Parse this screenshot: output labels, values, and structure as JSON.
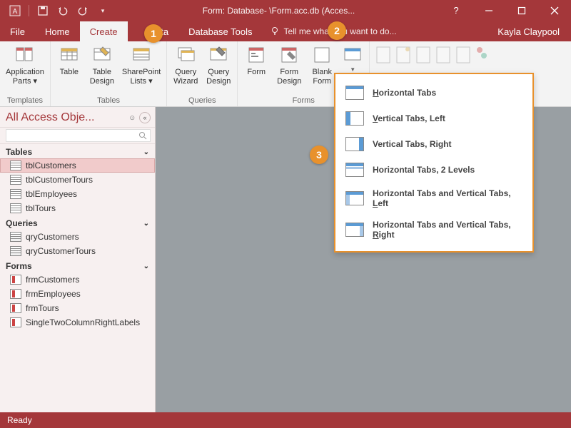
{
  "titlebar": {
    "title": "Form: Database- \\Form.acc.db (Acces..."
  },
  "user": "Kayla Claypool",
  "tabs": {
    "file": "File",
    "home": "Home",
    "create": "Create",
    "data": "Data",
    "dbtools": "Database Tools",
    "tellme": "Tell me what you want to do..."
  },
  "ribbon": {
    "appParts": "Application\nParts ▾",
    "table": "Table",
    "tableDesign": "Table\nDesign",
    "sharepoint": "SharePoint\nLists ▾",
    "queryWizard": "Query\nWizard",
    "queryDesign": "Query\nDesign",
    "form": "Form",
    "formDesign": "Form\nDesign",
    "blankForm": "Blank\nForm",
    "groups": {
      "templates": "Templates",
      "tables": "Tables",
      "queries": "Queries",
      "forms": "Forms"
    }
  },
  "nav": {
    "title": "All Access Obje...",
    "sections": {
      "tables": "Tables",
      "queries": "Queries",
      "forms": "Forms"
    },
    "tables": [
      "tblCustomers",
      "tblCustomerTours",
      "tblEmployees",
      "tblTours"
    ],
    "queries": [
      "qryCustomers",
      "qryCustomerTours"
    ],
    "forms": [
      "frmCustomers",
      "frmEmployees",
      "frmTours",
      "SingleTwoColumnRightLabels"
    ]
  },
  "dropdown": {
    "items": [
      "Horizontal Tabs",
      "Vertical Tabs, Left",
      "Vertical Tabs, Right",
      "Horizontal Tabs, 2 Levels",
      "Horizontal Tabs and Vertical Tabs, Left",
      "Horizontal Tabs and Vertical Tabs, Right"
    ]
  },
  "status": "Ready",
  "callouts": {
    "c1": "1",
    "c2": "2",
    "c3": "3"
  }
}
